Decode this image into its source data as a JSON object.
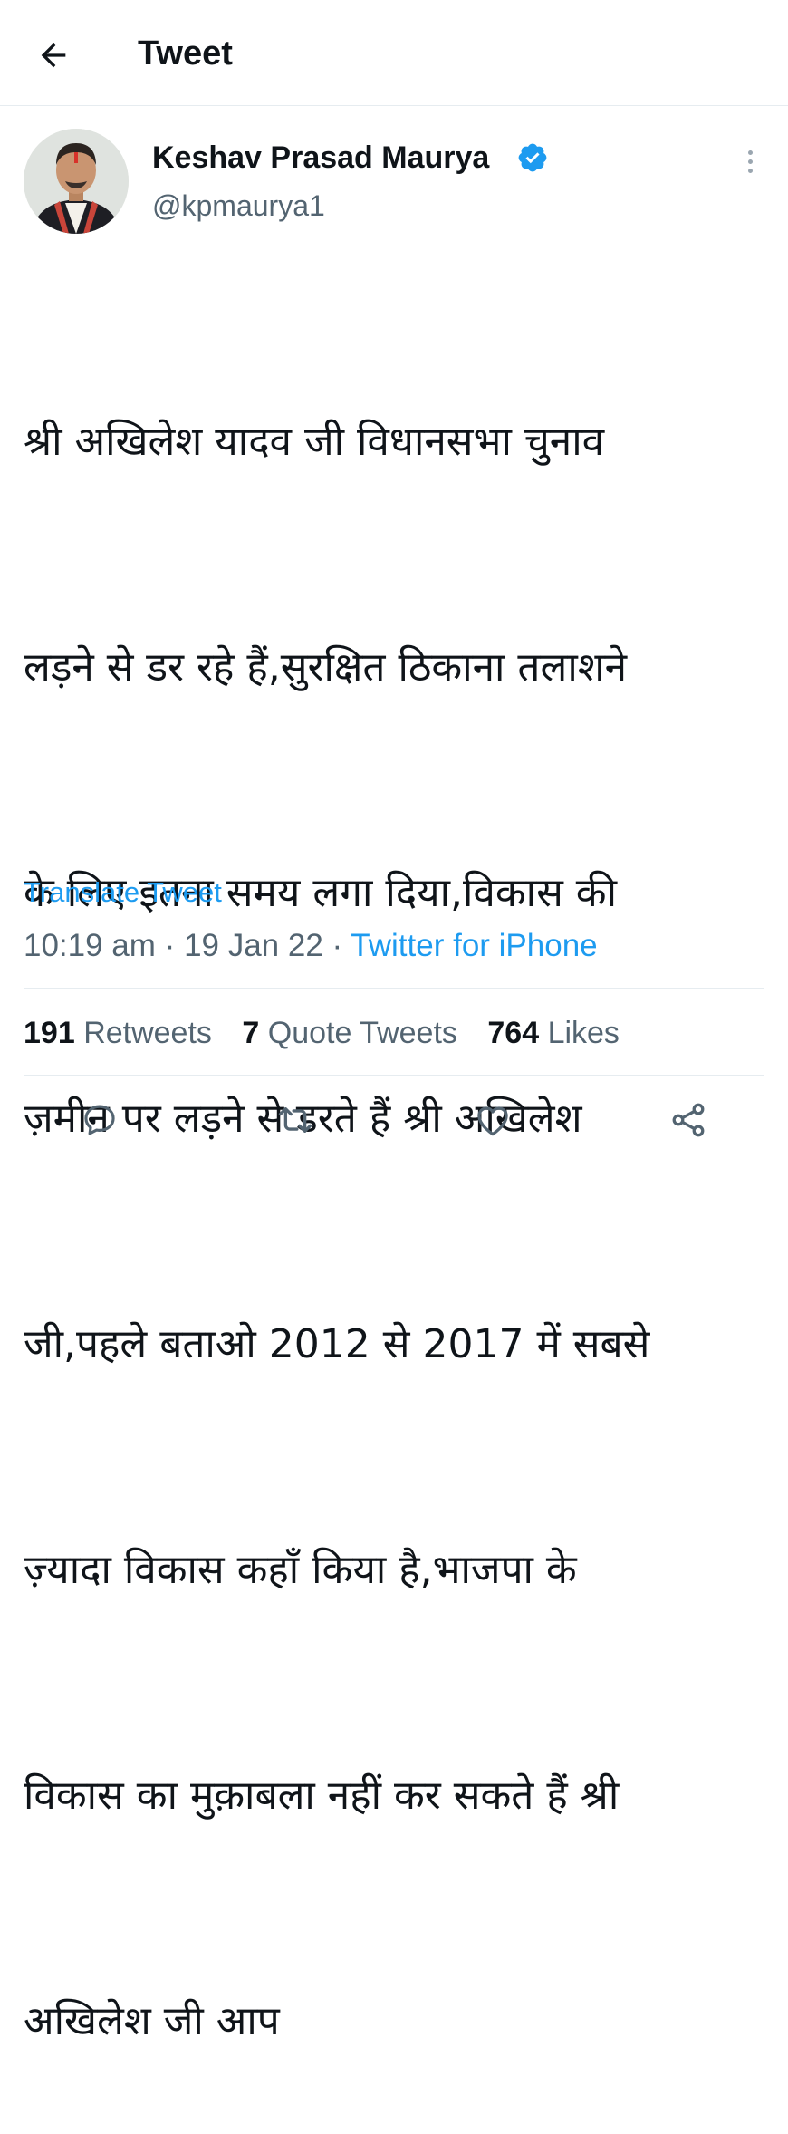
{
  "header": {
    "title": "Tweet"
  },
  "author": {
    "name": "Keshav Prasad Maurya",
    "handle": "@kpmaurya1",
    "verified": true
  },
  "tweet": {
    "lines": [
      "श्री अखिलेश यादव जी विधानसभा चुनाव",
      "लड़ने से डर रहे हैं,सुरक्षित ठिकाना तलाशने",
      "के लिए इतना समय लगा दिया,विकास की",
      "ज़मीन पर लड़ने से डरते हैं श्री अखिलेश",
      "जी,पहले बताओ 2012 से 2017 में सबसे",
      "ज़्यादा विकास कहाँ किया है,भाजपा के",
      "विकास का मुक़ाबला नहीं कर सकते हैं श्री",
      "अखिलेश जी आप"
    ],
    "translate_label": "Translate Tweet",
    "time": "10:19 am",
    "separator": "·",
    "date": "19 Jan 22",
    "source": "Twitter for iPhone"
  },
  "stats": {
    "retweets_count": "191",
    "retweets_label": "Retweets",
    "quotes_count": "7",
    "quotes_label": "Quote Tweets",
    "likes_count": "764",
    "likes_label": "Likes"
  },
  "icons": {
    "back": "arrow-left-icon",
    "verified": "verified-badge-icon",
    "more": "more-vertical-icon",
    "reply": "reply-icon",
    "retweet": "retweet-icon",
    "like": "heart-icon",
    "share": "share-icon"
  },
  "colors": {
    "accent": "#1d9bf0",
    "text": "#0f1419",
    "secondary": "#536471",
    "divider": "#e6ecf0"
  }
}
